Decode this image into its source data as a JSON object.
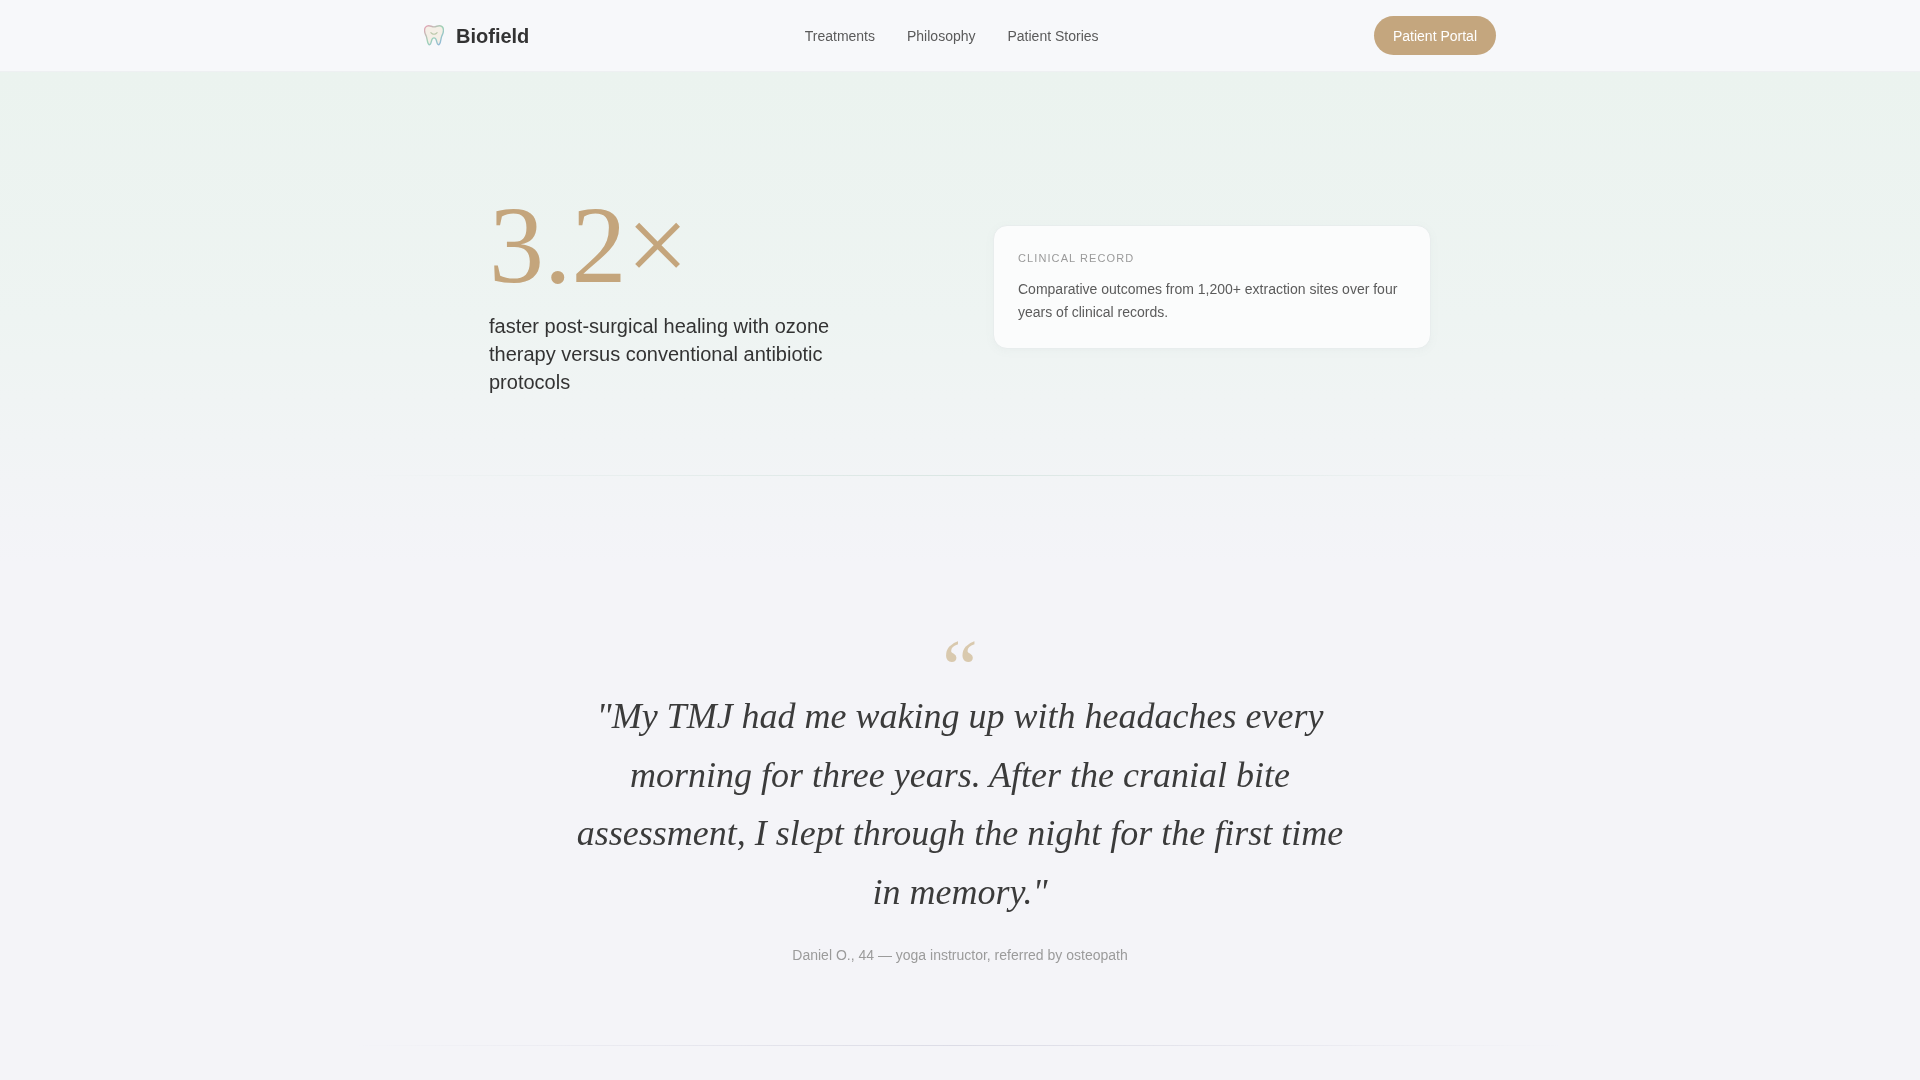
{
  "header": {
    "brand": "Biofield",
    "nav": [
      "Treatments",
      "Philosophy",
      "Patient Stories"
    ],
    "cta": "Patient Portal"
  },
  "stat": {
    "value": "3.2×",
    "description": "faster post-surgical healing with ozone therapy versus conventional antibiotic protocols"
  },
  "record_card": {
    "label": "CLINICAL RECORD",
    "text": "Comparative outcomes from 1,200+ extraction sites over four years of clinical records."
  },
  "testimonial": {
    "mark": "“",
    "quote": "\"My TMJ had me waking up with headaches every morning for three years. After the cranial bite assessment, I slept through the night for the first time in memory.\"",
    "attribution": "Daniel O., 44 — yoga instructor, referred by osteopath"
  }
}
